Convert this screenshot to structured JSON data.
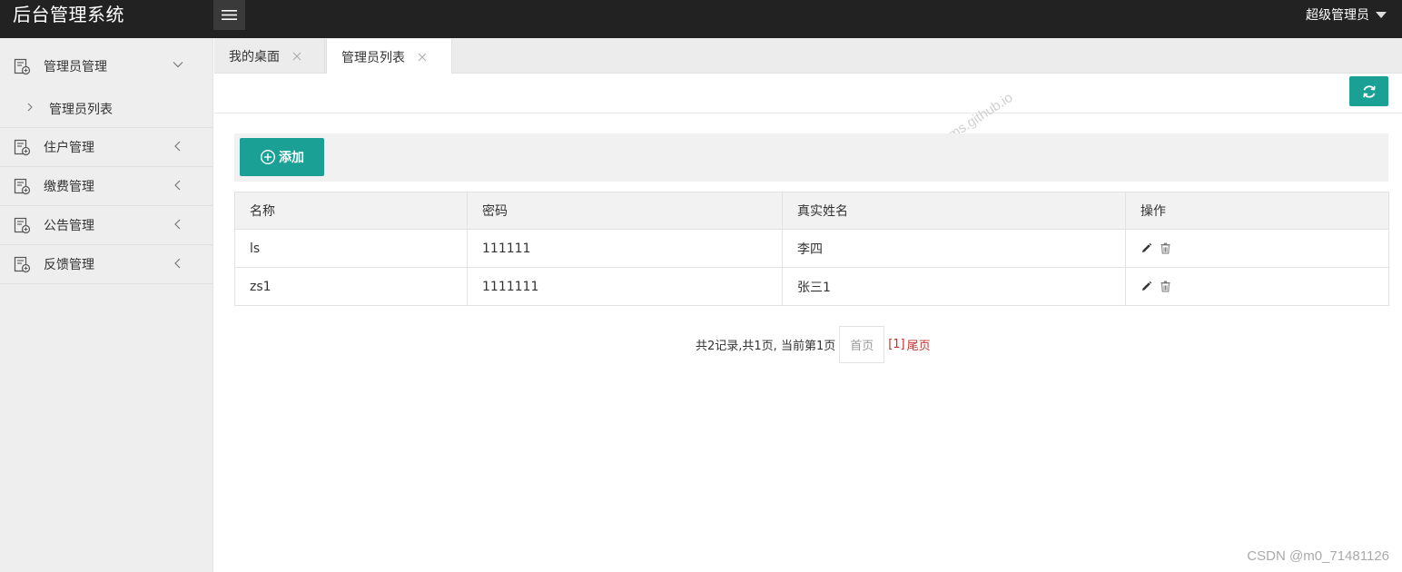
{
  "app": {
    "title": "后台管理系统",
    "user": "超级管理员"
  },
  "sidebar": {
    "items": [
      {
        "label": "管理员管理",
        "open": true,
        "children": [
          {
            "label": "管理员列表"
          }
        ]
      },
      {
        "label": "住户管理"
      },
      {
        "label": "缴费管理"
      },
      {
        "label": "公告管理"
      },
      {
        "label": "反馈管理"
      }
    ]
  },
  "tabs": [
    {
      "label": "我的桌面",
      "active": false
    },
    {
      "label": "管理员列表",
      "active": true
    }
  ],
  "toolbar": {
    "add_label": "添加"
  },
  "table": {
    "headers": [
      "名称",
      "密码",
      "真实姓名",
      "操作"
    ],
    "rows": [
      {
        "name": "ls",
        "password": "111111",
        "real_name": "李四"
      },
      {
        "name": "zs1",
        "password": "1111111",
        "real_name": "张三1"
      }
    ]
  },
  "pagination": {
    "summary": "共2记录,共1页, 当前第1页",
    "first_label": "首页",
    "current_label": "[1]",
    "last_label": "尾页"
  },
  "watermarks": {
    "csdn": "CSDN @m0_71481126",
    "github": "javayms.github.io"
  },
  "colors": {
    "accent": "#1aa094",
    "topbar": "#222222",
    "sidebar": "#eeeeee",
    "page_link": "#c9302c"
  },
  "icons": {
    "menu": "hamburger-icon",
    "nav": "document-icon",
    "refresh": "refresh-icon",
    "add": "plus-circle-icon",
    "edit": "pencil-icon",
    "delete": "trash-icon"
  }
}
